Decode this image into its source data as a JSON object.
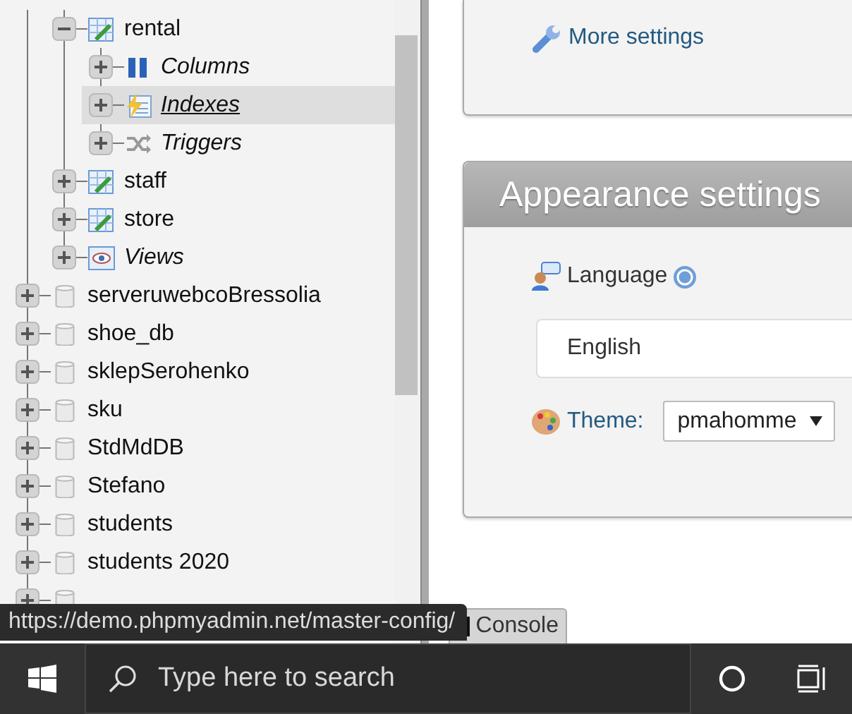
{
  "navigation_tree": [
    {
      "kind": "database",
      "children": [
        {
          "kind": "table",
          "name": "rental",
          "expanded": true,
          "selected": false,
          "children": [
            {
              "kind": "columns",
              "name": "Columns",
              "expanded": false,
              "selected": false
            },
            {
              "kind": "indexes",
              "name": "Indexes",
              "expanded": false,
              "selected": true
            },
            {
              "kind": "triggers",
              "name": "Triggers",
              "expanded": false,
              "selected": false
            }
          ]
        },
        {
          "kind": "table",
          "name": "staff",
          "expanded": false,
          "selected": false
        },
        {
          "kind": "table",
          "name": "store",
          "expanded": false,
          "selected": false
        },
        {
          "kind": "views",
          "name": "Views",
          "expanded": false,
          "selected": false
        }
      ]
    },
    {
      "kind": "database",
      "name": "serveruwebcoBressolia",
      "expanded": false,
      "selected": false
    },
    {
      "kind": "database",
      "name": "shoe_db",
      "expanded": false,
      "selected": false
    },
    {
      "kind": "database",
      "name": "sklepSerohenko",
      "expanded": false,
      "selected": false
    },
    {
      "kind": "database",
      "name": "sku",
      "expanded": false,
      "selected": false
    },
    {
      "kind": "database",
      "name": "StdMdDB",
      "expanded": false,
      "selected": false
    },
    {
      "kind": "database",
      "name": "Stefano",
      "expanded": false,
      "selected": false
    },
    {
      "kind": "database",
      "name": "students",
      "expanded": false,
      "selected": false
    },
    {
      "kind": "database",
      "name": "students 2020",
      "expanded": false,
      "selected": false
    },
    {
      "kind": "database",
      "expanded": false,
      "selected": false
    }
  ],
  "more_settings_link": "More settings",
  "appearance_settings": {
    "title": "Appearance settings",
    "language_label": "Language",
    "language_value": "English",
    "theme_label": "Theme:",
    "theme_value": "pmahomme"
  },
  "link_tooltip": "https://demo.phpmyadmin.net/master-config/",
  "console_tab": "Console",
  "taskbar": {
    "search_placeholder": "Type here to search"
  }
}
